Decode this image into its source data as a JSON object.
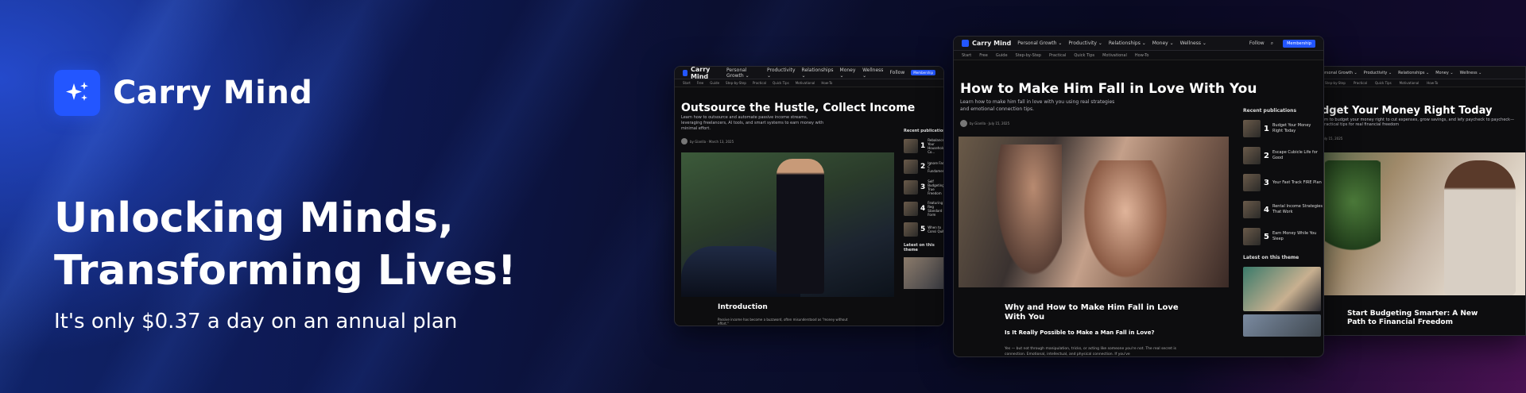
{
  "brand": {
    "name": "Carry Mind"
  },
  "hero": {
    "headline_line1": "Unlocking Minds,",
    "headline_line2": "Transforming Lives!",
    "subline": "It's only $0.37 a day on an annual plan"
  },
  "colors": {
    "accent": "#2356ff",
    "background": "#0a0a1e"
  },
  "site": {
    "nav": [
      "Personal Growth ⌄",
      "Productivity ⌄",
      "Relationships ⌄",
      "Money ⌄",
      "Wellness ⌄"
    ],
    "follow": "Follow",
    "membership": "Membership",
    "subnav": [
      "Start",
      "Free",
      "Guide",
      "Step-by-Step",
      "Practical",
      "Quick Tips",
      "Motivational",
      "How-To"
    ],
    "recent_heading": "Recent publications",
    "latest_heading": "Latest on this theme"
  },
  "shot1": {
    "title": "Outsource the Hustle, Collect Income",
    "excerpt": "Learn how to outsource and automate passive income streams, leveraging freelancers, AI tools, and smart systems to earn money with minimal effort.",
    "author": "by Gianlla · March 13, 2025",
    "section": "Introduction",
    "body": "Passive income has become a buzzword, often misunderstood as \"money without effort.\"",
    "recent": [
      {
        "num": "1",
        "label": "Rebalance Your Household Co..."
      },
      {
        "num": "2",
        "label": "Ignore Fads, C Fundamentals"
      },
      {
        "num": "3",
        "label": "Self Budgeting True Freedom"
      },
      {
        "num": "4",
        "label": "Featuring Reg Standard Form"
      },
      {
        "num": "5",
        "label": "When to Consi Quit?"
      }
    ]
  },
  "shot2": {
    "title": "How to Make Him Fall in Love With You",
    "excerpt": "Learn how to make him fall in love with you using real strategies and emotional connection tips.",
    "author": "by Gianlla · July 15, 2025",
    "section": "Why and How to Make Him Fall in Love With You",
    "subhead": "Is It Really Possible to Make a Man Fall in Love?",
    "body": "Yes — but not through manipulation, tricks, or acting like someone you're not. The real secret is connection. Emotional, intellectual, and physical connection. If you've",
    "recent": [
      {
        "num": "1",
        "label": "Budget Your Money Right Today"
      },
      {
        "num": "2",
        "label": "Escape Cubicle Life for Good"
      },
      {
        "num": "3",
        "label": "Your Fast Track FIRE Plan"
      },
      {
        "num": "4",
        "label": "Rental Income Strategies That Work"
      },
      {
        "num": "5",
        "label": "Earn Money While You Sleep"
      }
    ]
  },
  "shot3": {
    "title": "dget Your Money Right Today",
    "excerpt": "arn to budget your money right to cut expenses, grow savings, and lefy paycheck to paycheck—practical tips for real financial freedom",
    "author": "July 15, 2025",
    "section": "Start Budgeting Smarter: A New Path to Financial Freedom"
  }
}
